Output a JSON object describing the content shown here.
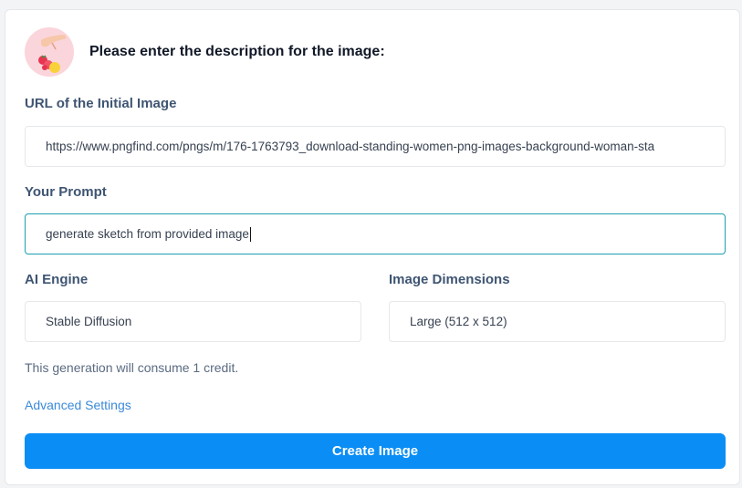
{
  "header": {
    "title": "Please enter the description for the image:",
    "avatar_icon": "hand-with-strawberries-icon"
  },
  "form": {
    "url_label": "URL of the Initial Image",
    "url_value": "https://www.pngfind.com/pngs/m/176-1763793_download-standing-women-png-images-background-woman-sta",
    "prompt_label": "Your Prompt",
    "prompt_value": "generate sketch from provided image",
    "engine_label": "AI Engine",
    "engine_value": "Stable Diffusion",
    "dimensions_label": "Image Dimensions",
    "dimensions_value": "Large (512 x 512)"
  },
  "note": "This generation will consume 1 credit.",
  "advanced_link": "Advanced Settings",
  "create_button": "Create Image",
  "colors": {
    "accent": "#0a8ef5",
    "label": "#3f5573",
    "link": "#3b8ad9",
    "focus_border": "#1a9fb0"
  }
}
